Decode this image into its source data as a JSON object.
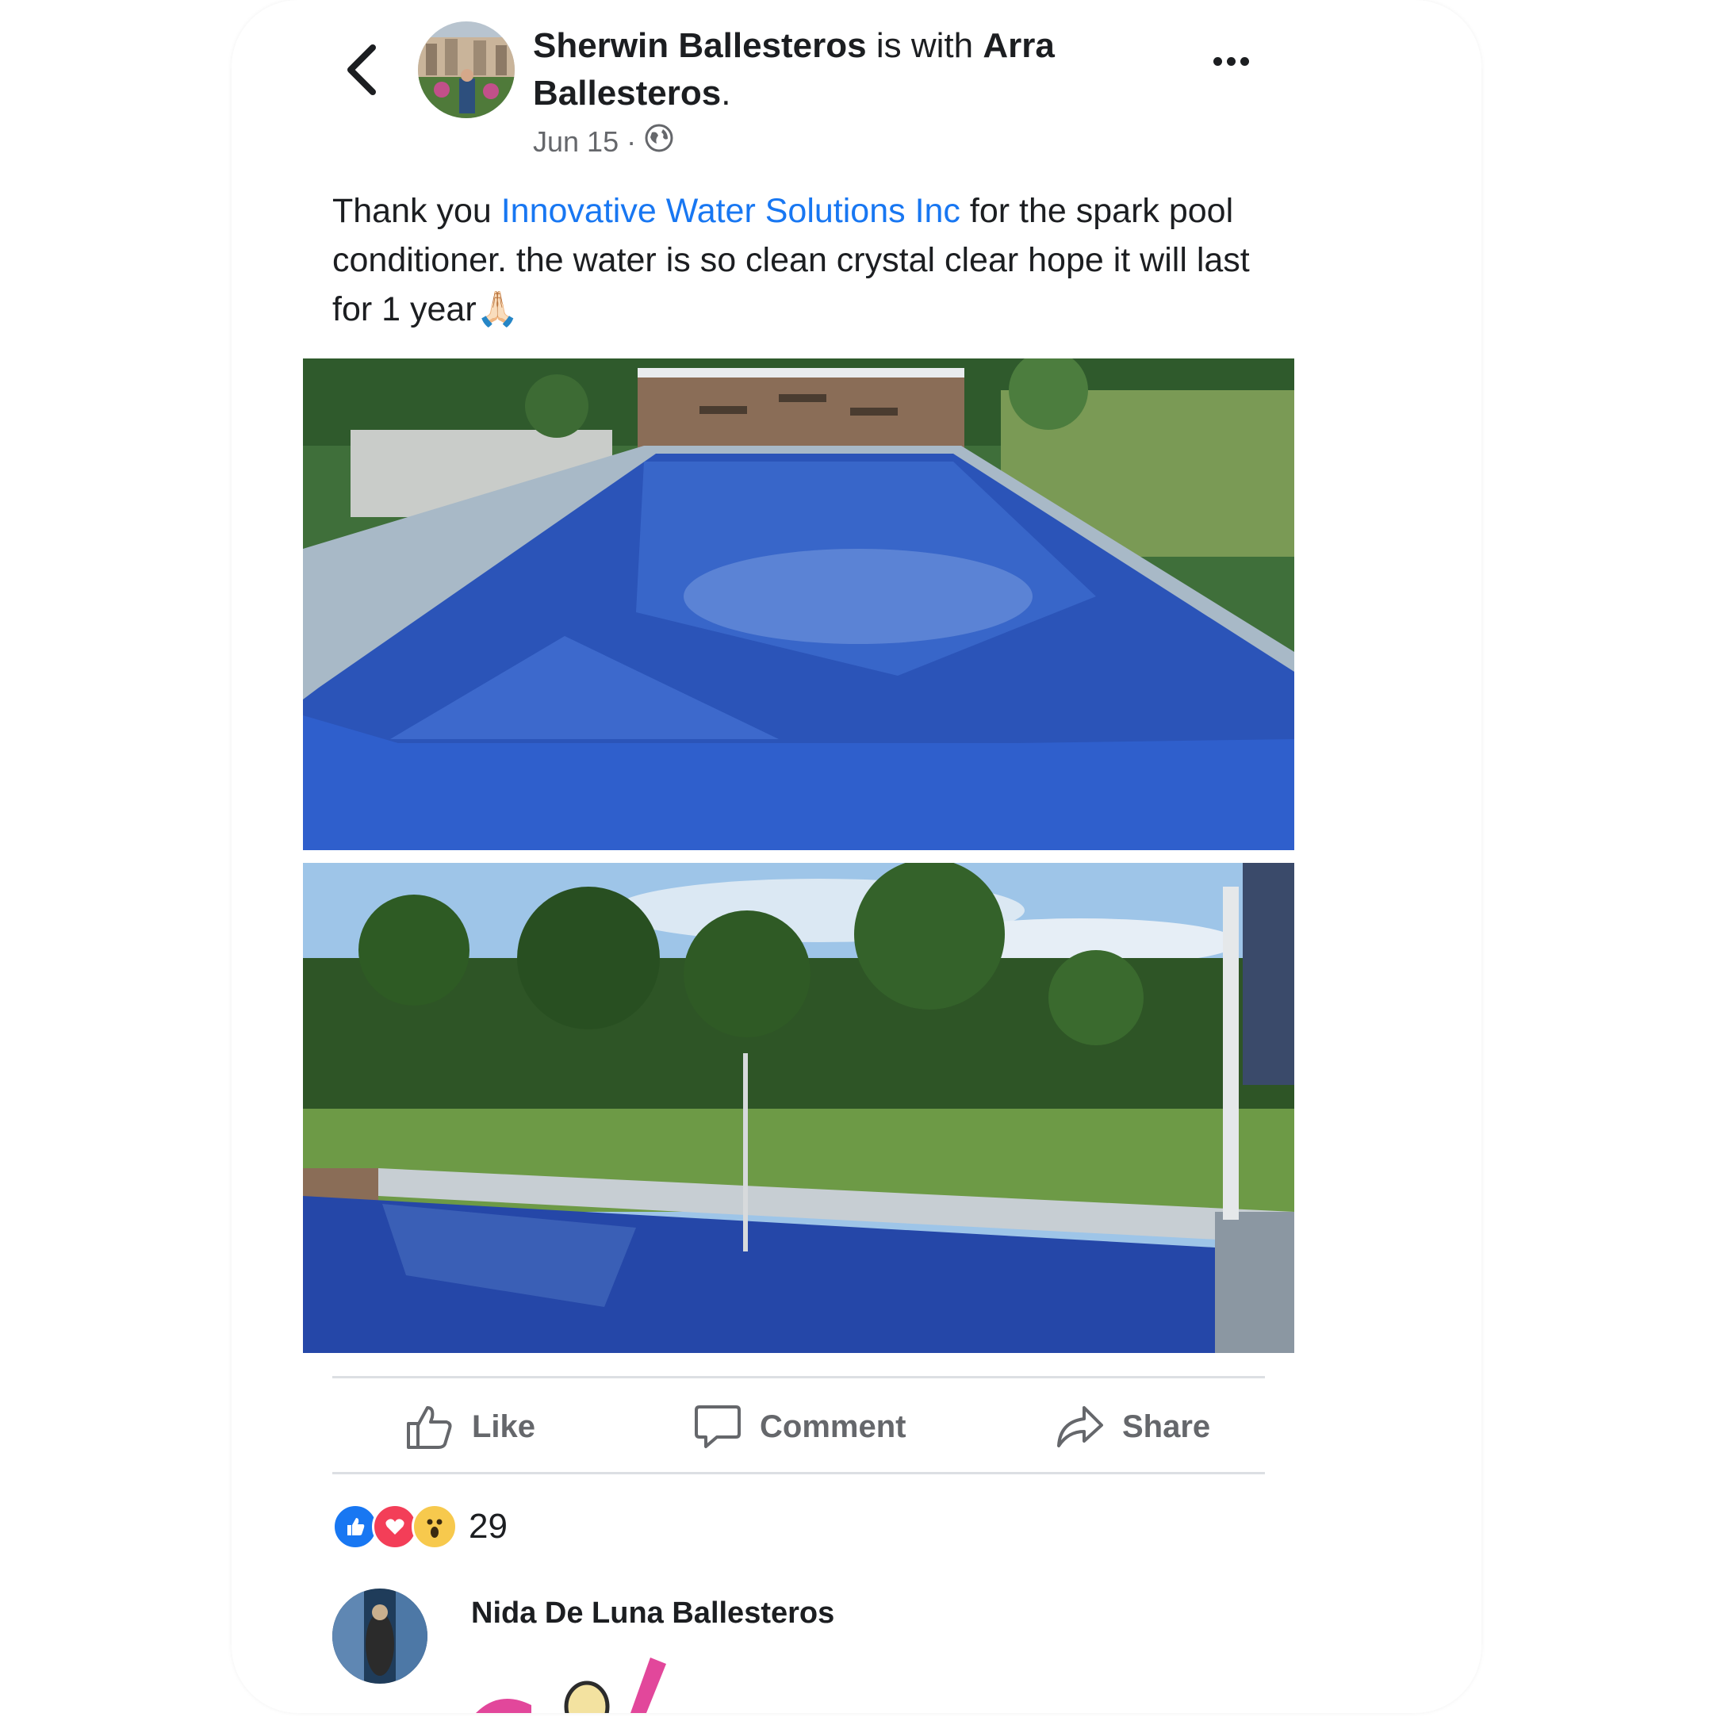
{
  "post": {
    "author_name": "Sherwin Ballesteros",
    "with_text": "is with",
    "tagged_name": "Arra Ballesteros",
    "tagged_suffix": ".",
    "date": "Jun 15",
    "separator": "·",
    "privacy_icon": "globe-icon",
    "text_prefix": "Thank you ",
    "mention": "Innovative Water Solutions Inc",
    "text_suffix": " for the spark pool conditioner. the water is so clean crystal clear hope it will last for 1 year",
    "emoji": "🙏🏻"
  },
  "actions": {
    "like": "Like",
    "comment": "Comment",
    "share": "Share"
  },
  "reactions": {
    "icons": [
      "like-reaction-icon",
      "love-reaction-icon",
      "wow-reaction-icon"
    ],
    "count": "29"
  },
  "comment": {
    "author_name": "Nida De Luna Ballesteros"
  },
  "colors": {
    "link": "#1877f2",
    "like_blue": "#1877f2",
    "love_pink": "#f33e58",
    "wow_yellow": "#f7c94d",
    "muted_text": "#65676b"
  }
}
